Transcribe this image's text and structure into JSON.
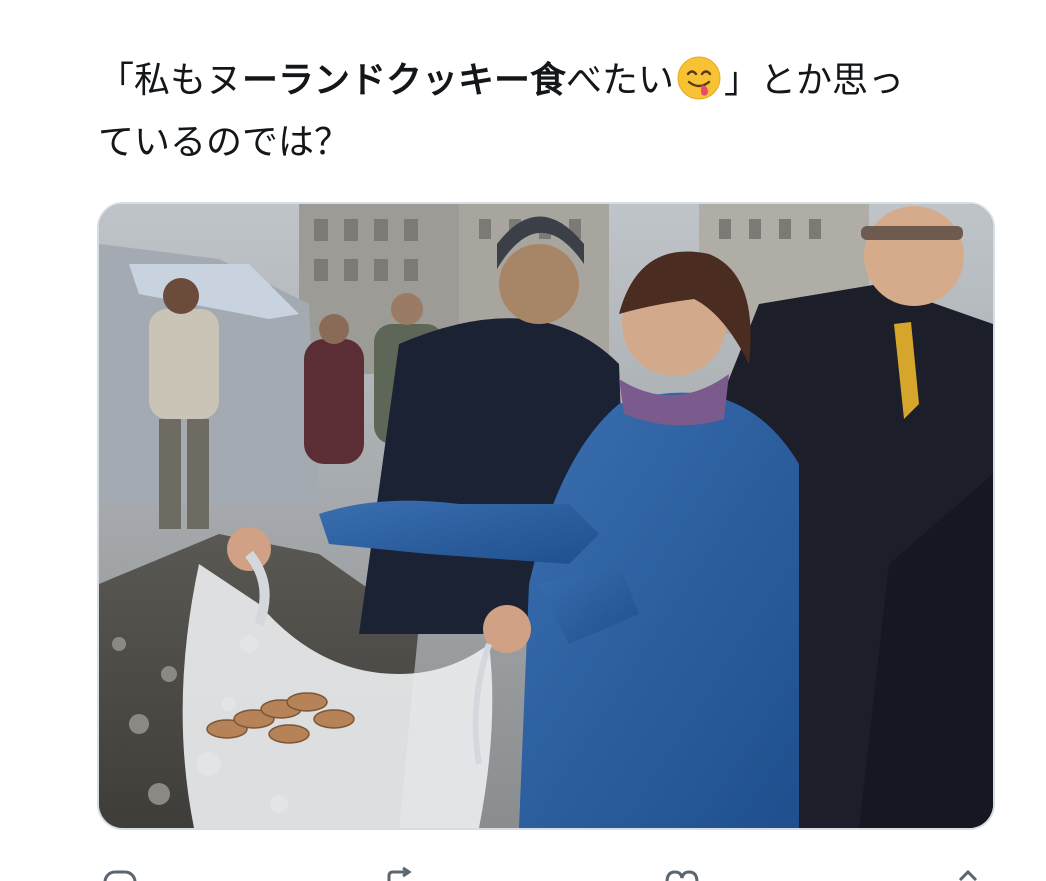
{
  "tweet": {
    "text_part1": "「私もヌ",
    "text_bold": "ーランドクッキー食",
    "text_part2": "べたい",
    "emoji": "face-savoring-food-emoji",
    "text_part3": "」とか思っ",
    "text_line2": "ているのでは？"
  },
  "media": {
    "photo": "protest-photo",
    "description_icons": [
      "woman-with-bag",
      "cookies",
      "crowd"
    ]
  },
  "actions": {
    "icons": [
      "reply-icon",
      "retweet-icon",
      "like-icon",
      "share-icon"
    ]
  }
}
